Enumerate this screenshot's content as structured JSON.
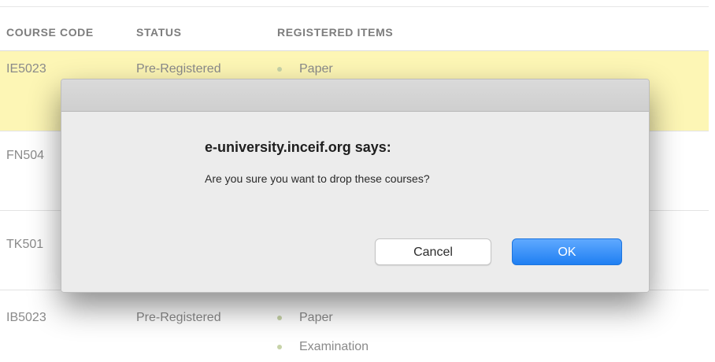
{
  "table": {
    "headers": {
      "course_code": "COURSE CODE",
      "status": "STATUS",
      "registered_items": "REGISTERED ITEMS"
    },
    "rows": [
      {
        "code": "IE5023",
        "status": "Pre-Registered",
        "items": [
          "Paper"
        ],
        "highlighted": true
      },
      {
        "code": "FN504",
        "status": "",
        "items": []
      },
      {
        "code": "TK501",
        "status": "",
        "items": []
      },
      {
        "code": "IB5023",
        "status": "Pre-Registered",
        "items": [
          "Paper",
          "Examination"
        ]
      }
    ]
  },
  "dialog": {
    "title": "e-university.inceif.org says:",
    "message": "Are you sure you want to drop these courses?",
    "cancel_label": "Cancel",
    "ok_label": "OK"
  },
  "colors": {
    "highlight_row": "#fdf6b5",
    "ok_button": "#1f7ff2"
  }
}
